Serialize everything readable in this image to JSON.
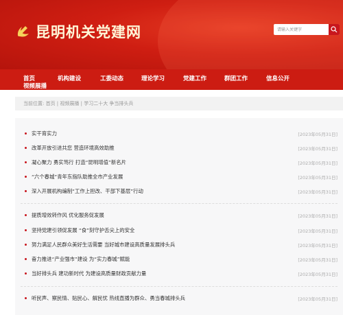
{
  "site": {
    "title": "昆明机关党建网",
    "logo_icon": "party-emblem-icon",
    "accent": "#cc1c12"
  },
  "search": {
    "placeholder": "请输入关键字"
  },
  "nav": [
    {
      "label": "首页"
    },
    {
      "label": "机构建设"
    },
    {
      "label": "工委动态"
    },
    {
      "label": "理论学习"
    },
    {
      "label": "党建工作"
    },
    {
      "label": "群团工作"
    },
    {
      "label": "信息公开"
    },
    {
      "label": "视频展播"
    }
  ],
  "breadcrumb": "当前位置: 首页 | 视频展播 | 学习二十大 争当排头兵",
  "articles": [
    {
      "title": "实干育实力",
      "date": "[2023年05月31日]"
    },
    {
      "title": "改革开放引进共您 营造环境高效助推",
      "date": "[2023年05月31日]"
    },
    {
      "title": "凝心聚力 勇实笃行 打造“昆明增值”新名片",
      "date": "[2023年05月31日]"
    },
    {
      "title": "“六个春城”青年东指队助推全市产业发展",
      "date": "[2023年05月31日]"
    },
    {
      "title": "深入开展机构编制“工作上担改、干部下基层”行动",
      "date": "[2023年05月31日]"
    },
    {
      "title": "提质增效转作风 优化服务促发展",
      "date": "[2023年05月31日]"
    },
    {
      "title": "坚持党建引领促发展 “食”刻守护舌尖上的安全",
      "date": "[2023年05月31日]"
    },
    {
      "title": "努力满足人民群众美好生活需要 当好城市建设高质量发展排头兵",
      "date": "[2023年05月31日]"
    },
    {
      "title": "奋力推进“产业强市”建设 为“实力春城”赋能",
      "date": "[2023年05月31日]"
    },
    {
      "title": "当好排头兵 建功新时代 为建设高质量财政贡献力量",
      "date": "[2023年05月31日]"
    },
    {
      "title": "听民声、察民情、贴民心、解民忧 热线直播为群众、勇当春城排头兵",
      "date": "[2023年05月31日]"
    }
  ]
}
